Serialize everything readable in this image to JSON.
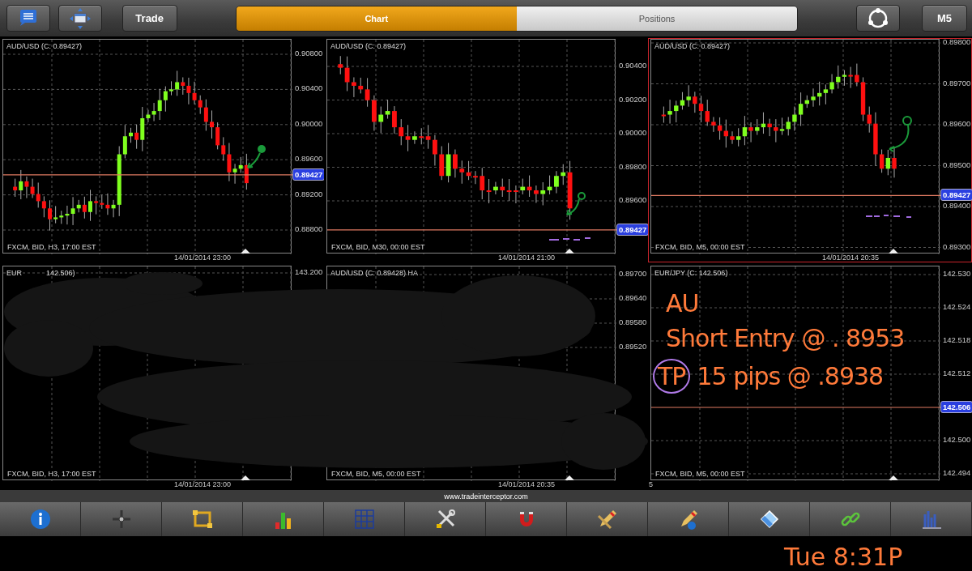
{
  "top_bar": {
    "left_buttons": [
      {
        "kind": "menu"
      },
      {
        "kind": "window"
      }
    ],
    "trade_button": "Trade",
    "tabs": [
      {
        "label": "Chart",
        "selected": true
      },
      {
        "label": "Positions",
        "selected": false
      }
    ],
    "timeframe_button": "M5"
  },
  "charts": [
    {
      "title_parts": [
        "AUD/USD (C: 0.89427)"
      ],
      "axis_labels": [
        "0.90800",
        "0.90400",
        "0.90000",
        "0.89600",
        "0.89200",
        "0.88800"
      ],
      "price": "0.89427",
      "footer": "FXCM, BID, H3, 17:00 EST",
      "date": "14/01/2014 23:00",
      "selected": false
    },
    {
      "title_parts": [
        "AUD/USD (C: 0.89427)"
      ],
      "axis_labels": [
        "0.90400",
        "0.90200",
        "0.90000",
        "0.89800",
        "0.89600"
      ],
      "price": "0.89427",
      "footer": "FXCM, BID, M30, 00:00 EST",
      "date": "14/01/2014 21:00",
      "selected": false
    },
    {
      "title_parts": [
        "AUD/USD (C: 0.89427)"
      ],
      "axis_labels": [
        "0.89800",
        "0.89700",
        "0.89600",
        "0.89500",
        "0.89400",
        "0.89300"
      ],
      "price": "0.89427",
      "footer": "FXCM, BID, M5, 00:00 EST",
      "date": "14/01/2014 20:35",
      "selected": true
    },
    {
      "title_parts": [
        "EUR",
        "142.506)"
      ],
      "axis_labels": [
        "143.200"
      ],
      "footer": "FXCM, BID, H3, 17:00 EST",
      "date": "14/01/2014 23:00",
      "selected": false
    },
    {
      "title_parts": [
        "AUD/USD (C: 0.89428) HA"
      ],
      "axis_labels": [
        "0.89700",
        "0.89640",
        "0.89580",
        "0.89520"
      ],
      "footer": "FXCM, BID, M5, 00:00 EST",
      "date": "14/01/2014 20:35",
      "selected": false
    },
    {
      "title_parts": [
        "EUR/JPY (C: 142.506)"
      ],
      "axis_labels": [
        "142.530",
        "142.524",
        "142.518",
        "142.512",
        "142.500",
        "142.494"
      ],
      "price": "142.506",
      "footer": "FXCM, BID, M5, 00:00 EST",
      "date": "5",
      "selected": false,
      "notes": [
        [
          {
            "text": "AU",
            "circled": false
          }
        ],
        [
          {
            "text": "Short Entry @ . 8953",
            "circled": false
          }
        ],
        [
          {
            "text": "TP",
            "circled": true
          },
          {
            "text": "15 pips @ .8938",
            "circled": false
          }
        ]
      ]
    }
  ],
  "website": "www.tradeinterceptor.com",
  "handwritten_time": "Tue 8:31P"
}
